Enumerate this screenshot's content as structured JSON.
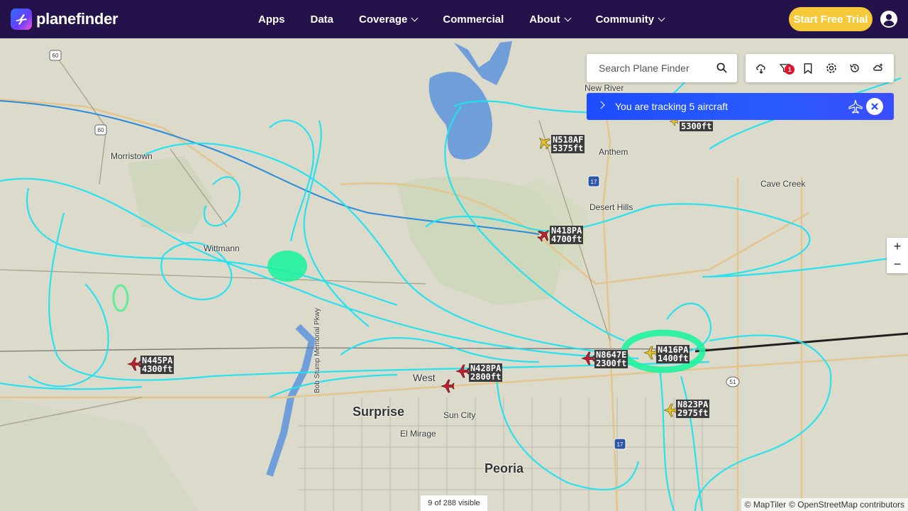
{
  "brand": {
    "name": "planefinder"
  },
  "nav": {
    "items": [
      {
        "label": "Apps",
        "has_menu": false
      },
      {
        "label": "Data",
        "has_menu": false
      },
      {
        "label": "Coverage",
        "has_menu": true
      },
      {
        "label": "Commercial",
        "has_menu": false
      },
      {
        "label": "About",
        "has_menu": true
      },
      {
        "label": "Community",
        "has_menu": true
      }
    ],
    "cta_label": "Start Free Trial",
    "account_icon": "user-circle-icon"
  },
  "search": {
    "placeholder": "Search Plane Finder"
  },
  "toolbar": {
    "icons": [
      "weather-icon",
      "filter-icon",
      "bookmark-icon",
      "settings-icon",
      "history-icon",
      "ar-view-icon"
    ],
    "filter_badge": "1"
  },
  "tracking": {
    "text": "You are tracking 5 aircraft"
  },
  "zoom": {
    "in": "+",
    "out": "−"
  },
  "status": {
    "visible": "9 of 288 visible"
  },
  "attribution": {
    "maptiler": "© MapTiler",
    "osm": "© OpenStreetMap contributors"
  },
  "aircraft": [
    {
      "callsign": "N518AF",
      "altitude": "5375ft",
      "color": "#e3c22a"
    },
    {
      "callsign": "N418PA",
      "altitude": "4700ft",
      "color": "#c21f2f"
    },
    {
      "callsign": "N445PA",
      "altitude": "4300ft",
      "color": "#c21f2f"
    },
    {
      "callsign": "N428PA",
      "altitude": "2800ft",
      "color": "#c21f2f"
    },
    {
      "callsign": "N8647E",
      "altitude": "2300ft",
      "color": "#c21f2f"
    },
    {
      "callsign": "N416PA",
      "altitude": "1400ft",
      "color": "#e3c22a"
    },
    {
      "callsign": "N823PA",
      "altitude": "2975ft",
      "color": "#e3c22a"
    },
    {
      "callsign": "",
      "altitude": "5300ft",
      "color": "#e3c22a"
    }
  ],
  "places": {
    "morristown": "Morristown",
    "wittmann": "Wittmann",
    "new_river": "New River",
    "anthem": "Anthem",
    "cave_creek": "Cave Creek",
    "desert_hills": "Desert Hills",
    "surprise": "Surprise",
    "sun_city": "Sun City",
    "el_mirage": "El Mirage",
    "peoria": "Peoria",
    "west": "West",
    "bob_stump": "Bob Stump Memorial Pkwy"
  },
  "shields": {
    "us60a": "60",
    "us60b": "60",
    "i17a": "17",
    "i17b": "17",
    "sr51": "51"
  },
  "colors": {
    "topbar": "#24124a",
    "cta": "#f5c93a",
    "tracking": "#1d4cff",
    "track": "#1ee3f0",
    "badge": "#e4132b"
  }
}
